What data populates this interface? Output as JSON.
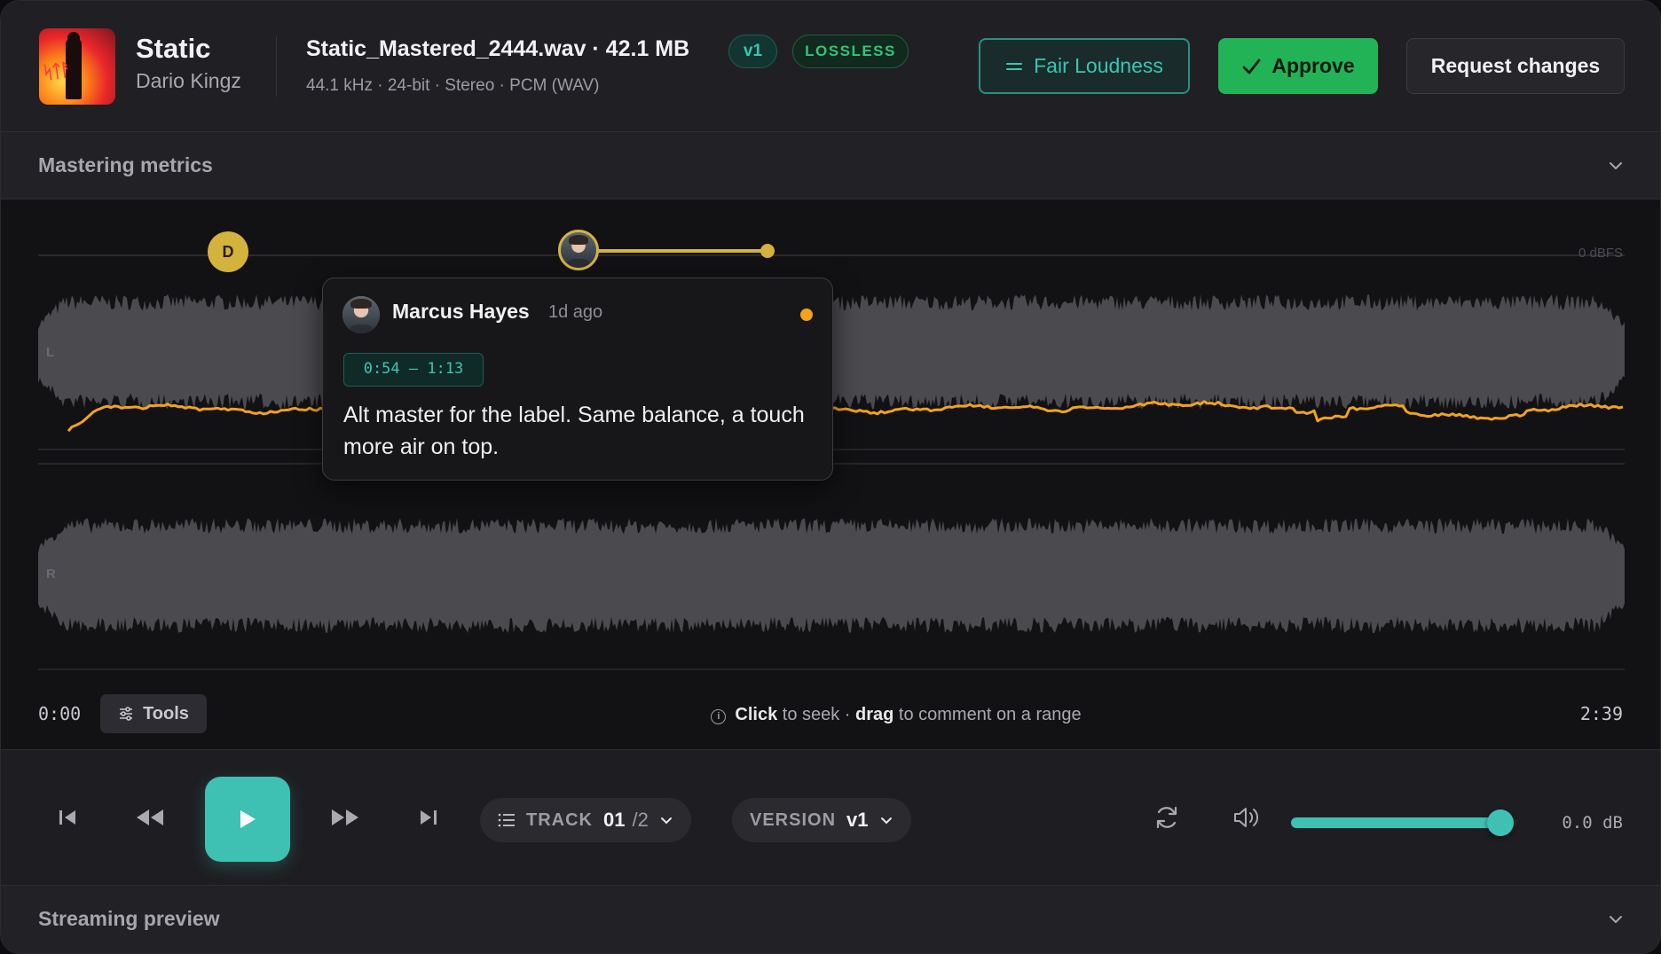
{
  "track": {
    "title": "Static",
    "artist": "Dario Kingz",
    "file_name": "Static_Mastered_2444.wav · 42.1 MB",
    "file_meta": "44.1 kHz · 24-bit · Stereo · PCM (WAV)",
    "version_badge": "v1",
    "quality_badge": "LOSSLESS"
  },
  "actions": {
    "fair_loudness": "Fair Loudness",
    "approve": "Approve",
    "request_changes": "Request changes"
  },
  "metrics": {
    "title": "Mastering metrics"
  },
  "waveform": {
    "left_label": "L",
    "right_label": "R",
    "dbfs_label": "0 dBFS",
    "marker_initial": "D",
    "time_start": "0:00",
    "time_end": "2:39",
    "tools_label": "Tools",
    "hint_click": "Click",
    "hint_seek": " to seek · ",
    "hint_drag": "drag",
    "hint_rest": " to comment on a range",
    "loudness_color": "#f2a31c"
  },
  "comment": {
    "author": "Marcus Hayes",
    "time": "1d ago",
    "range": "0:54 – 1:13",
    "text": "Alt master for the label. Same balance, a touch more air on top.",
    "status_color": "#f2a31c"
  },
  "transport": {
    "track_label": "TRACK",
    "track_current": "01",
    "track_total": "/2",
    "version_label": "VERSION",
    "version_value": "v1",
    "volume": 0.93,
    "gain": "0.0 dB"
  },
  "streaming": {
    "title": "Streaming preview"
  },
  "colors": {
    "accent": "#3ec1b2",
    "approve": "#22b357",
    "marker": "#d4b23e"
  }
}
